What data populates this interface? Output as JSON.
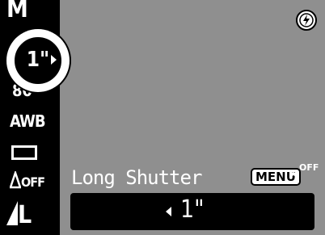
{
  "sidebar": {
    "mode_icon_text": "M",
    "iso_label": "80",
    "wb_label": "AWB",
    "ioff_label": "OFF",
    "quality_label": "L"
  },
  "selector": {
    "value": "1\""
  },
  "caption": {
    "text": "Long Shutter"
  },
  "menu_button": {
    "label": "MENU"
  },
  "night_icon": {
    "label": "OFF"
  },
  "value_bar": {
    "value": "1\""
  },
  "colors": {
    "screen_bg": "#8f8f8f",
    "panel_bg": "#000000",
    "text": "#ffffff"
  }
}
